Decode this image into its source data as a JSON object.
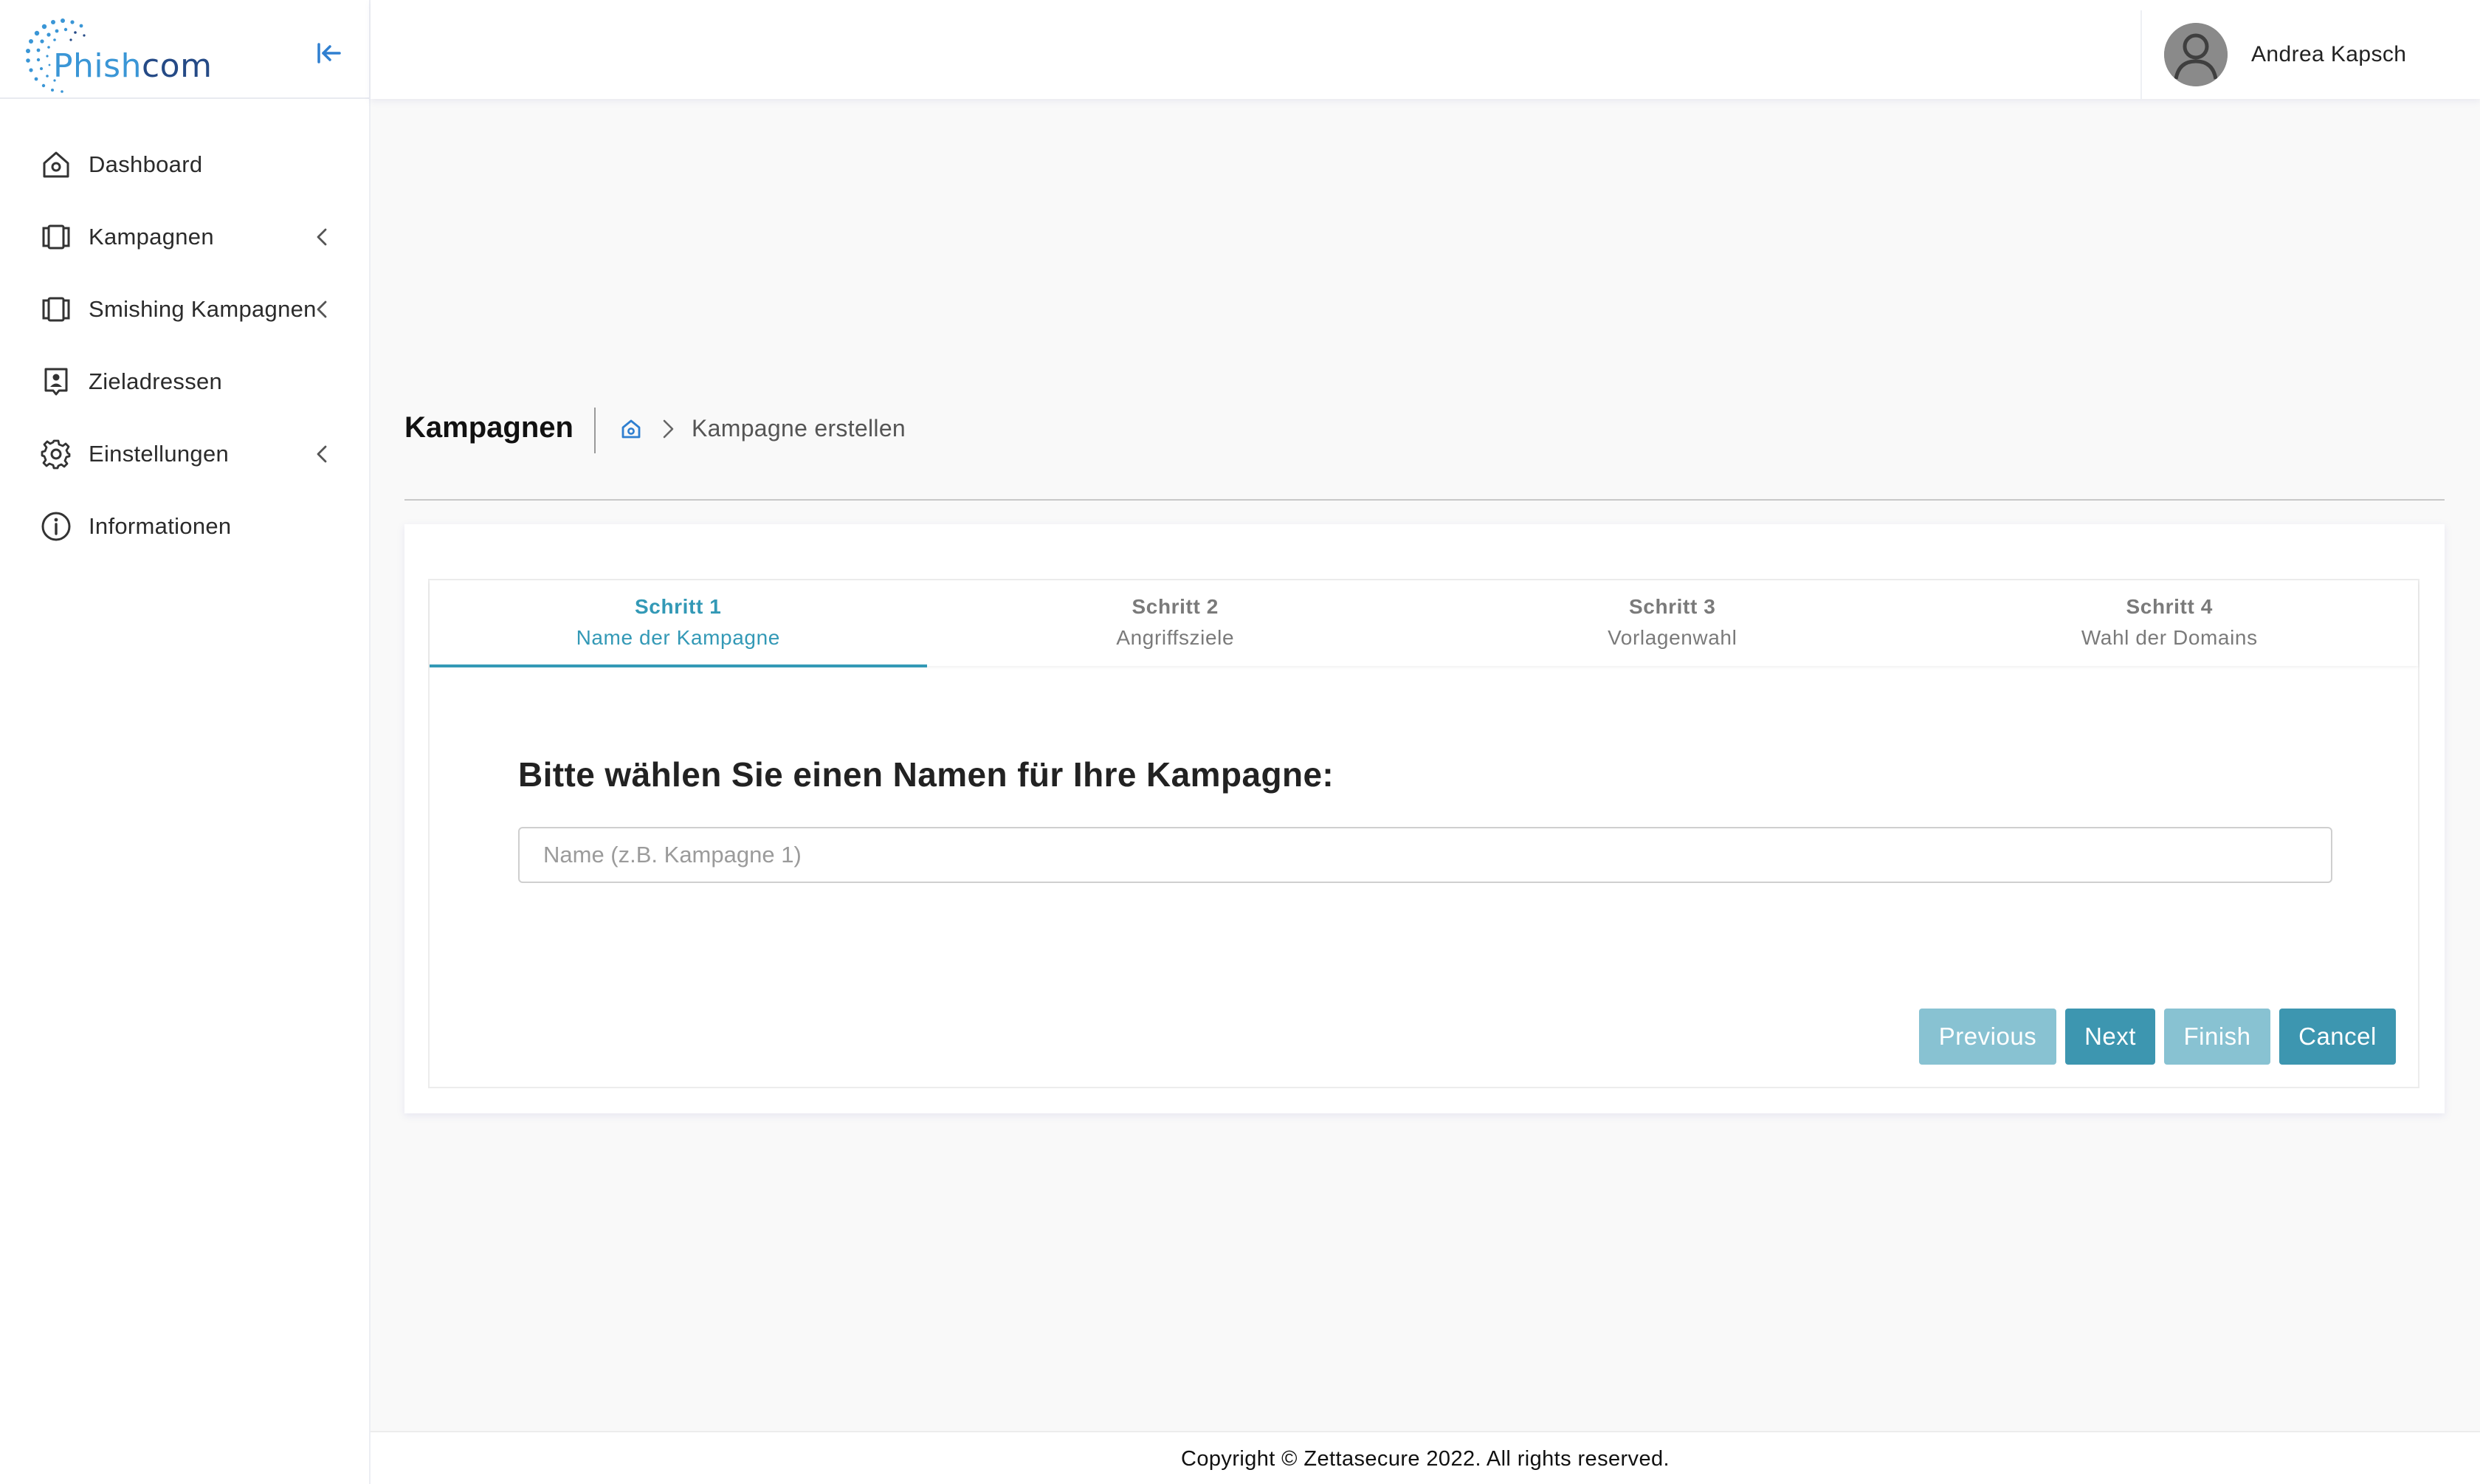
{
  "brand": {
    "logo_prefix": "Phish",
    "logo_suffix": "com"
  },
  "sidebar": {
    "items": [
      {
        "label": "Dashboard",
        "icon": "home-icon",
        "has_submenu": false
      },
      {
        "label": "Kampagnen",
        "icon": "campaign-icon",
        "has_submenu": true
      },
      {
        "label": "Smishing Kampagnen",
        "icon": "campaign-icon",
        "has_submenu": true
      },
      {
        "label": "Zieladressen",
        "icon": "contact-card-icon",
        "has_submenu": false
      },
      {
        "label": "Einstellungen",
        "icon": "gear-icon",
        "has_submenu": true
      },
      {
        "label": "Informationen",
        "icon": "info-icon",
        "has_submenu": false
      }
    ]
  },
  "header": {
    "user_name": "Andrea Kapsch"
  },
  "page": {
    "title": "Kampagnen",
    "breadcrumb_current": "Kampagne erstellen"
  },
  "wizard": {
    "steps": [
      {
        "number": "Schritt 1",
        "name": "Name der Kampagne",
        "active": true
      },
      {
        "number": "Schritt 2",
        "name": "Angriffsziele",
        "active": false
      },
      {
        "number": "Schritt 3",
        "name": "Vorlagenwahl",
        "active": false
      },
      {
        "number": "Schritt 4",
        "name": "Wahl der Domains",
        "active": false
      }
    ],
    "question": "Bitte wählen Sie einen Namen für Ihre Kampagne:",
    "name_input": {
      "value": "",
      "placeholder": "Name (z.B. Kampagne 1)"
    },
    "buttons": {
      "previous": "Previous",
      "next": "Next",
      "finish": "Finish",
      "cancel": "Cancel"
    }
  },
  "footer": {
    "copyright": "Copyright © Zettasecure 2022. All rights reserved."
  },
  "colors": {
    "accent": "#3399b6",
    "button_primary": "#3d96b0",
    "button_disabled": "#88c2d2",
    "logo_blue": "#3a96d6",
    "collapse_icon": "#2f7fd0"
  }
}
